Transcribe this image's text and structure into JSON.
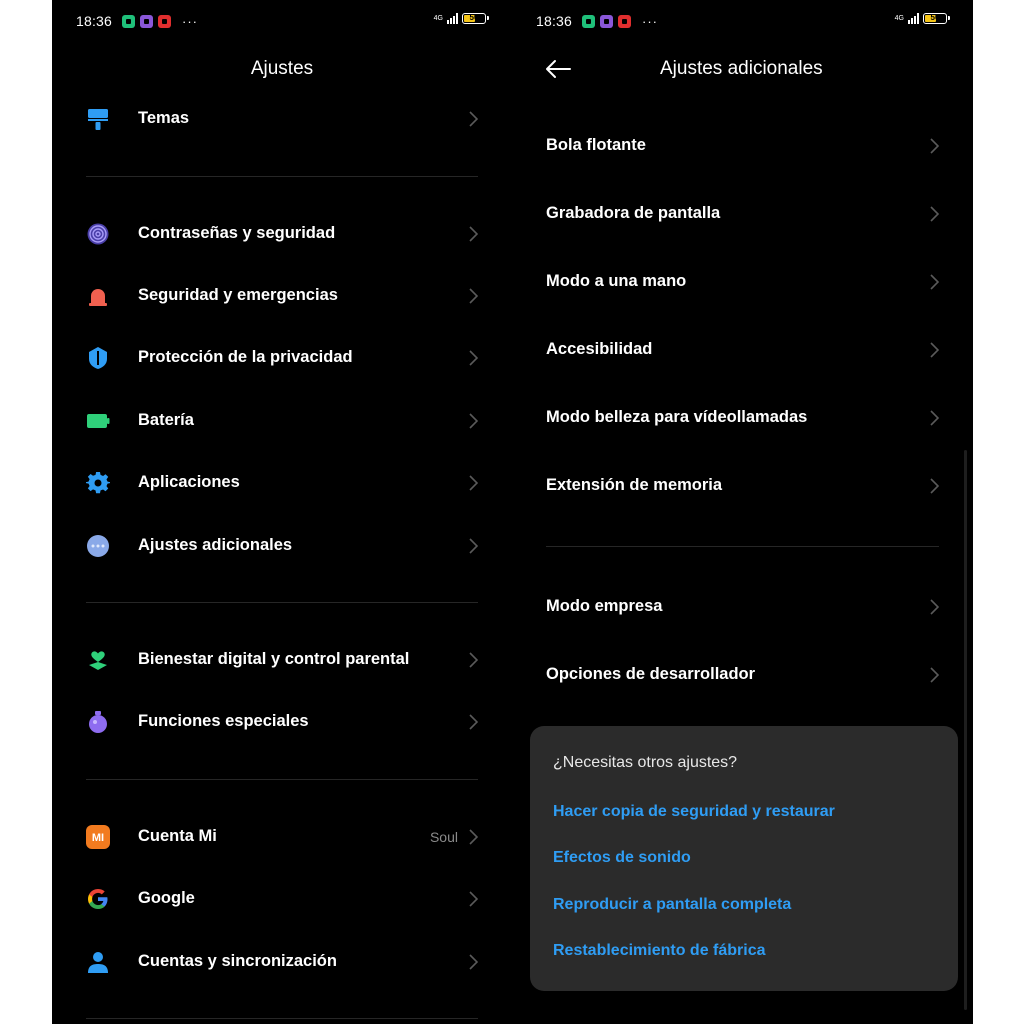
{
  "status": {
    "time": "18:36",
    "network": "4G",
    "battery": "50",
    "more_indicator": "···",
    "notif_colors": [
      "#1fc07a",
      "#8a57d8",
      "#e02e2e"
    ]
  },
  "left": {
    "title": "Ajustes",
    "items": [
      {
        "label": "Temas",
        "icon": "theme-icon",
        "color": "#2f9df4"
      },
      {
        "label": "Contraseñas y seguridad",
        "icon": "fingerprint-icon",
        "color": "#7b6cf0"
      },
      {
        "label": "Seguridad y emergencias",
        "icon": "emergency-icon",
        "color": "#f0604f"
      },
      {
        "label": "Protección de la privacidad",
        "icon": "privacy-shield-icon",
        "color": "#2f9df4"
      },
      {
        "label": "Batería",
        "icon": "battery-icon",
        "color": "#2fd07a"
      },
      {
        "label": "Aplicaciones",
        "icon": "gear-icon",
        "color": "#2f9df4"
      },
      {
        "label": "Ajustes adicionales",
        "icon": "more-dots-icon",
        "color": "#8aa9e8"
      },
      {
        "label": "Bienestar digital y control parental",
        "icon": "wellbeing-icon",
        "color": "#2fd07a"
      },
      {
        "label": "Funciones especiales",
        "icon": "special-features-icon",
        "color": "#8e6cf0"
      },
      {
        "label": "Cuenta Mi",
        "icon": "mi-account-icon",
        "color": "#f27b1f",
        "value": "Soul",
        "mi_text": "MI"
      },
      {
        "label": "Google",
        "icon": "google-icon",
        "color": "#4285f4",
        "g_text": "G"
      },
      {
        "label": "Cuentas y sincronización",
        "icon": "account-sync-icon",
        "color": "#2f9df4"
      }
    ]
  },
  "right": {
    "title": "Ajustes adicionales",
    "items": [
      "Bola flotante",
      "Grabadora de pantalla",
      "Modo a una mano",
      "Accesibilidad",
      "Modo belleza para vídeollamadas",
      "Extensión de memoria",
      "Modo empresa",
      "Opciones de desarrollador"
    ],
    "card": {
      "title": "¿Necesitas otros ajustes?",
      "links": [
        "Hacer copia de seguridad y restaurar",
        "Efectos de sonido",
        "Reproducir a pantalla completa",
        "Restablecimiento de fábrica"
      ],
      "link_color": "#2f9df4"
    }
  }
}
